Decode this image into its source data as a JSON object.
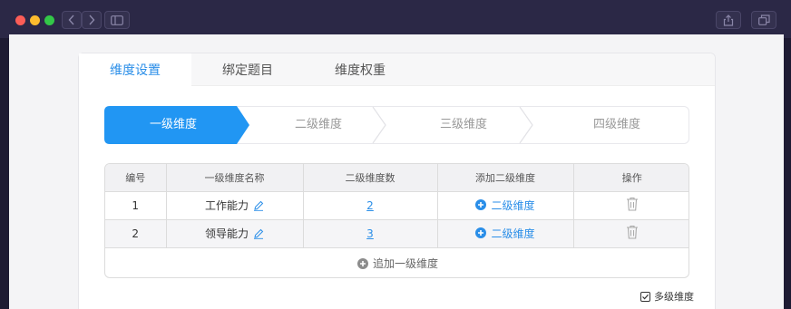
{
  "tabs": [
    {
      "label": "维度设置",
      "active": true
    },
    {
      "label": "绑定题目",
      "active": false
    },
    {
      "label": "维度权重",
      "active": false
    }
  ],
  "steps": [
    {
      "label": "一级维度",
      "active": true
    },
    {
      "label": "二级维度",
      "active": false
    },
    {
      "label": "三级维度",
      "active": false
    },
    {
      "label": "四级维度",
      "active": false
    }
  ],
  "table": {
    "headers": [
      "编号",
      "一级维度名称",
      "二级维度数",
      "添加二级维度",
      "操作"
    ],
    "rows": [
      {
        "no": "1",
        "name": "工作能力",
        "count": "2",
        "add_label": "二级维度"
      },
      {
        "no": "2",
        "name": "领导能力",
        "count": "3",
        "add_label": "二级维度"
      }
    ],
    "add_row_label": "追加一级维度"
  },
  "multi_level": {
    "label": "多级维度",
    "checked": true
  },
  "colors": {
    "accent": "#2a8ee8",
    "step_active": "#2196f3"
  }
}
